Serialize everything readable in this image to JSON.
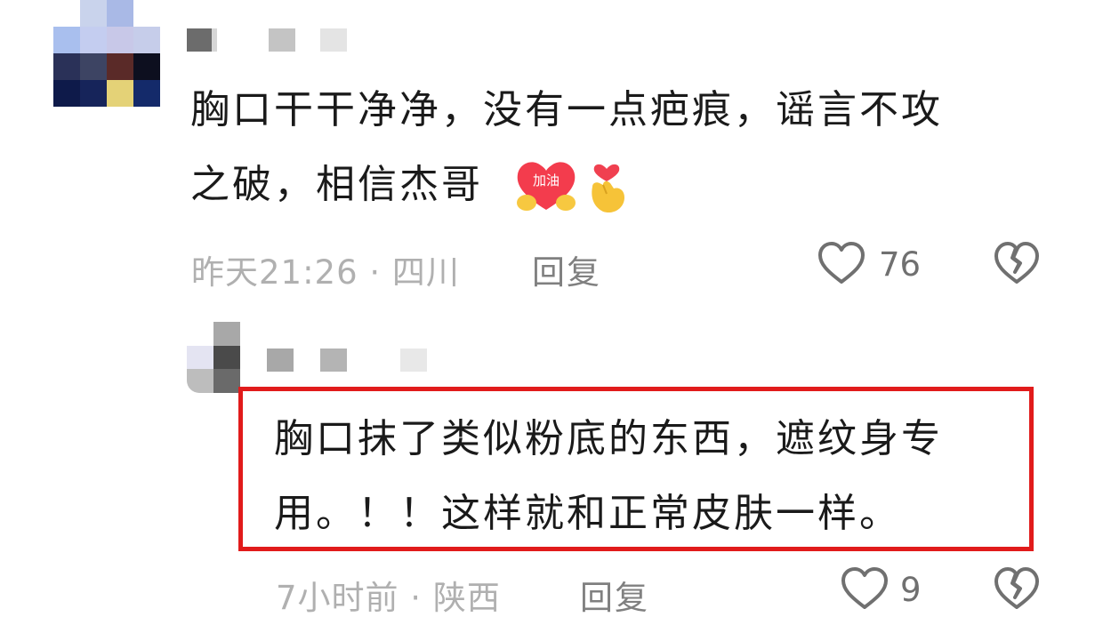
{
  "comments": [
    {
      "text_line1": "胸口干干净净，没有一点疤痕，谣言不攻",
      "text_line2": "之破，相信杰哥",
      "badge_text": "加油",
      "emojis": [
        "heart-jiayou-emoji",
        "finger-heart-emoji"
      ],
      "time": "昨天21:26 · 四川",
      "reply_label": "回复",
      "likes": "76"
    },
    {
      "text_line1": "胸口抹了类似粉底的东西，遮纹身专",
      "text_line2": "用。！！这样就和正常皮肤一样。",
      "time": "7小时前 · 陕西",
      "reply_label": "回复",
      "likes": "9",
      "highlighted": true
    }
  ],
  "colors": {
    "highlight": "#e11b1b",
    "meta": "#b0b0b0",
    "reply": "#808080"
  },
  "icons": [
    "heart-outline-icon",
    "broken-heart-icon"
  ]
}
